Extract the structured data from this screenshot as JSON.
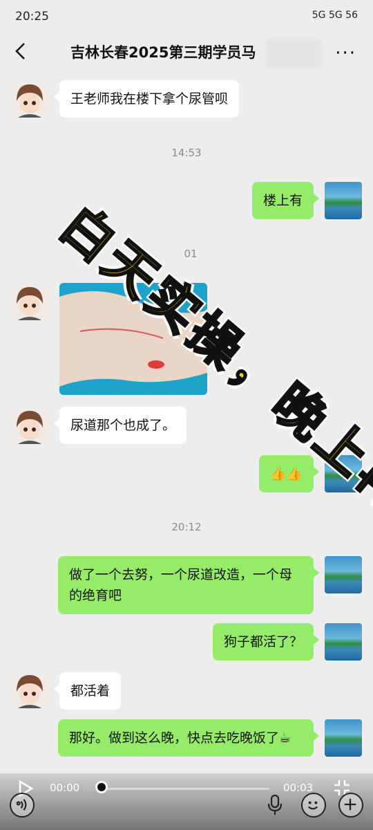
{
  "status_bar": {
    "time": "20:25",
    "icons": "5G 5G 56"
  },
  "header": {
    "title": "吉林长春2025第三期学员马",
    "more": "···"
  },
  "overlay_caption": "白天实操，晚上再练",
  "messages": [
    {
      "side": "left",
      "type": "text",
      "text": "王老师我在楼下拿个尿管呗"
    },
    {
      "type": "time",
      "text": "14:53"
    },
    {
      "side": "right",
      "type": "text",
      "text": "楼上有"
    },
    {
      "type": "time",
      "text": "01"
    },
    {
      "side": "left",
      "type": "image"
    },
    {
      "side": "left",
      "type": "text",
      "text": "尿道那个也成了。"
    },
    {
      "side": "right",
      "type": "text",
      "text": "👍👍"
    },
    {
      "type": "time",
      "text": "20:12"
    },
    {
      "side": "right",
      "type": "text",
      "text": "做了一个去努，一个尿道改造，一个母的绝育吧"
    },
    {
      "side": "right",
      "type": "text",
      "text": "狗子都活了？"
    },
    {
      "side": "left",
      "type": "text",
      "text": "都活着"
    },
    {
      "side": "right",
      "type": "text",
      "text": "那好。做到这么晚，快点去吃晚饭了☕"
    }
  ],
  "player": {
    "current_time": "00:00",
    "duration": "00:03",
    "progress": 0.0
  },
  "icons": {
    "back": "chevron-left-icon",
    "more": "more-icon",
    "play": "play-icon",
    "fullscreen": "fullscreen-icon",
    "voice": "voice-icon",
    "mic": "mic-icon",
    "emoji": "emoji-icon",
    "plus": "plus-icon"
  },
  "colors": {
    "background": "#ededed",
    "outgoing_bubble": "#95ec69",
    "incoming_bubble": "#ffffff",
    "overlay_text": "#ffd400"
  }
}
